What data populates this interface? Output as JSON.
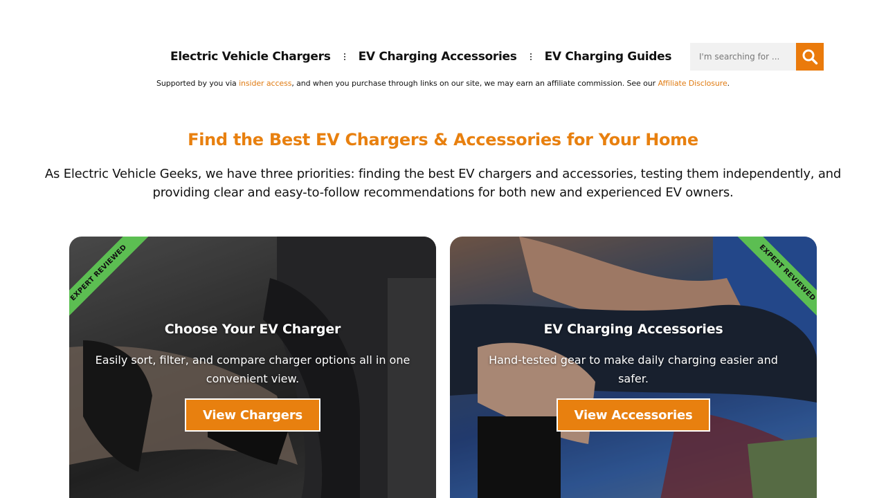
{
  "nav": {
    "links": [
      "Electric Vehicle Chargers",
      "EV Charging Accessories",
      "EV Charging Guides"
    ]
  },
  "search": {
    "placeholder": "I'm searching for ...",
    "icon": "search-icon",
    "color": "#ea7a0b"
  },
  "affiliate": {
    "prefix": "Supported by you via ",
    "link1": "insider access",
    "middle": ", and when you purchase through links on our site, we may earn an affiliate commission. See our ",
    "link2": "Affiliate Disclosure",
    "suffix": "."
  },
  "hero": {
    "title": "Find the Best EV Chargers & Accessories for Your Home",
    "text": "As Electric Vehicle Geeks, we have three priorities: finding the best EV chargers and accessories, testing them independently, and providing clear and easy-to-follow recommendations for both new and experienced EV owners."
  },
  "cards": [
    {
      "ribbon": "EXPERT REVIEWED",
      "title": "Choose Your EV Charger",
      "description": "Easily sort, filter, and compare charger options all in one convenient view.",
      "button": "View Chargers"
    },
    {
      "ribbon": "EXPERT REVIEWED",
      "title": "EV Charging Accessories",
      "description": "Hand-tested gear to make daily charging easier and safer.",
      "button": "View Accessories"
    }
  ],
  "colors": {
    "accent": "#e8800f",
    "ribbon": "#5cbe52"
  }
}
